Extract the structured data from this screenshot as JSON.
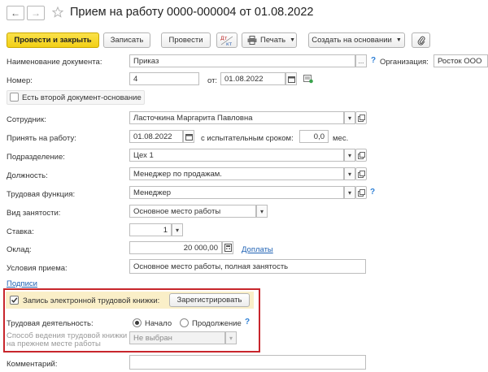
{
  "header": {
    "title": "Прием на работу 0000-000004 от 01.08.2022"
  },
  "toolbar": {
    "post_close": "Провести и закрыть",
    "save": "Записать",
    "post": "Провести",
    "print": "Печать",
    "create_based": "Создать на основании"
  },
  "form": {
    "doc_name_label": "Наименование документа:",
    "doc_name_value": "Приказ",
    "org_label": "Организация:",
    "org_value": "Росток ООО",
    "number_label": "Номер:",
    "number_value": "4",
    "from_label": "от:",
    "date_value": "01.08.2022",
    "second_doc_label": "Есть второй документ-основание",
    "employee_label": "Сотрудник:",
    "employee_value": "Ласточкина Маргарита Павловна",
    "hire_label": "Принять на работу:",
    "hire_date": "01.08.2022",
    "trial_label": "с испытательным сроком:",
    "trial_value": "0,0",
    "trial_unit": "мес.",
    "dept_label": "Подразделение:",
    "dept_value": "Цех 1",
    "position_label": "Должность:",
    "position_value": "Менеджер по продажам.",
    "labor_func_label": "Трудовая функция:",
    "labor_func_value": "Менеджер",
    "employment_label": "Вид занятости:",
    "employment_value": "Основное место работы",
    "rate_label": "Ставка:",
    "rate_value": "1",
    "salary_label": "Оклад:",
    "salary_value": "20 000,00",
    "salary_link": "Доплаты",
    "conditions_label": "Условия приема:",
    "conditions_value": "Основное место работы, полная занятость",
    "signatures_link": "Подписи",
    "etk_label": "Запись электронной трудовой книжки:",
    "register_button": "Зарегистрировать",
    "activity_label": "Трудовая деятельность:",
    "activity_start": "Начало",
    "activity_continue": "Продолжение",
    "method_label_1": "Способ ведения трудовой книжки",
    "method_label_2": "на прежнем месте работы",
    "method_value": "Не выбран",
    "comment_label": "Комментарий:",
    "comment_value": ""
  }
}
